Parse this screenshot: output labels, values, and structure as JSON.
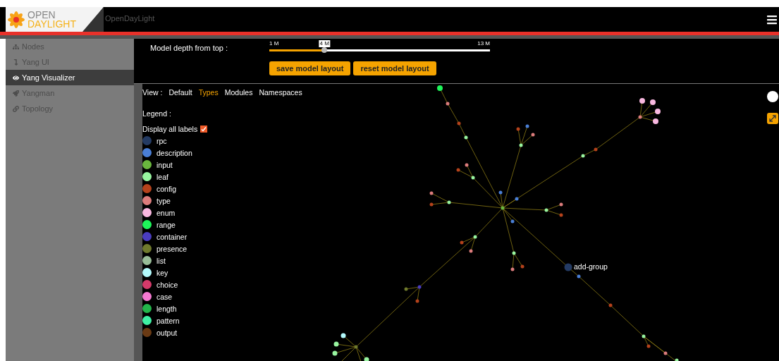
{
  "header": {
    "logo_top": "OPEN",
    "logo_bottom": "DAYLIGHT",
    "title": "OpenDayLight"
  },
  "sidebar": {
    "items": [
      {
        "label": "Nodes",
        "kind": "sitemap",
        "selected": false
      },
      {
        "label": "Yang UI",
        "kind": "arrow",
        "selected": false
      },
      {
        "label": "Yang Visualizer",
        "kind": "eye",
        "selected": true
      },
      {
        "label": "Yangman",
        "kind": "rocket",
        "selected": false
      },
      {
        "label": "Topology",
        "kind": "link",
        "selected": false
      }
    ]
  },
  "depth": {
    "label": "Model depth from top :",
    "min_label": "1 M",
    "value_label": "4 M",
    "max_label": "13 M",
    "level": 0.25
  },
  "buttons": [
    "save model layout",
    "reset model layout"
  ],
  "view": {
    "label": "View :",
    "options": [
      {
        "label": "Default",
        "selected": false
      },
      {
        "label": "Types",
        "selected": true
      },
      {
        "label": "Modules",
        "selected": false
      },
      {
        "label": "Namespaces",
        "selected": false
      }
    ]
  },
  "legend": {
    "title": "Legend :",
    "display_all_labels": {
      "label": "Display all labels",
      "checked": true
    },
    "entries": [
      {
        "label": "rpc",
        "color": "#243b63"
      },
      {
        "label": "description",
        "color": "#4a7fd6"
      },
      {
        "label": "input",
        "color": "#6ab73e"
      },
      {
        "label": "leaf",
        "color": "#98f5a0"
      },
      {
        "label": "config",
        "color": "#b5421b"
      },
      {
        "label": "type",
        "color": "#dc7c7c"
      },
      {
        "label": "enum",
        "color": "#f9b8e0"
      },
      {
        "label": "range",
        "color": "#1ef55a"
      },
      {
        "label": "container",
        "color": "#4a3cc0"
      },
      {
        "label": "presence",
        "color": "#6f7a2c"
      },
      {
        "label": "list",
        "color": "#98bd98"
      },
      {
        "label": "key",
        "color": "#b4fafc"
      },
      {
        "label": "choice",
        "color": "#d43a6a"
      },
      {
        "label": "case",
        "color": "#f57ad2"
      },
      {
        "label": "length",
        "color": "#23b54a"
      },
      {
        "label": "pattern",
        "color": "#3ff0a4"
      },
      {
        "label": "output",
        "color": "#6a3a14"
      }
    ]
  },
  "graph": {
    "node_label": "add-group"
  }
}
